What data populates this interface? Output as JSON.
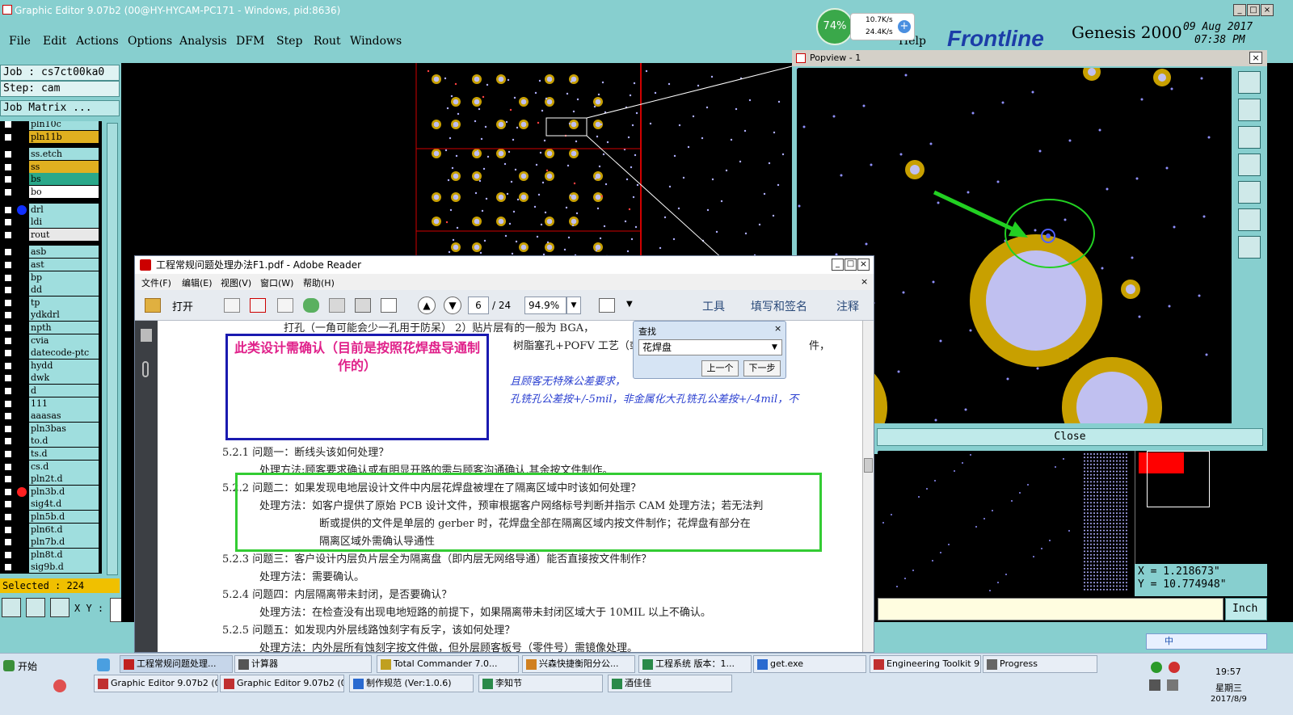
{
  "window": {
    "title": "Graphic Editor 9.07b2 (00@HY-HYCAM-PC171 - Windows, pid:8636)"
  },
  "menu": [
    "File",
    "Edit",
    "Actions",
    "Options",
    "Analysis",
    "DFM",
    "Step",
    "Rout",
    "Windows"
  ],
  "help_label": "Help",
  "brand": {
    "logo": "Frontline",
    "product": "Genesis 2000",
    "date": "09 Aug 2017",
    "time": "07:38 PM"
  },
  "net_widget": {
    "percent": "74%",
    "up": "10.7K/s",
    "down": "24.4K/s"
  },
  "job": {
    "job_label": "Job : cs7ct00ka0",
    "step_label": "Step: cam",
    "matrix_button": "Job Matrix ..."
  },
  "layers": [
    "pln10c",
    "pln11b",
    "ss.etch",
    "ss",
    "bs",
    "bo",
    "drl",
    "ldi",
    "rout",
    "asb",
    "ast",
    "bp",
    "dd",
    "tp",
    "ydkdrl",
    "npth",
    "cvia",
    "datecode-ptc",
    "hydd",
    "dwk",
    "d",
    "111",
    "aaasas",
    "pln3bas",
    "to.d",
    "ts.d",
    "cs.d",
    "pln2t.d",
    "pln3b.d",
    "sig4t.d",
    "pln5b.d",
    "pln6t.d",
    "pln7b.d",
    "pln8t.d",
    "sig9b.d"
  ],
  "selected": "Selected : 224",
  "xy_label": "X Y :",
  "popview": {
    "title": "Popview - 1",
    "close_label": "Close"
  },
  "coords": {
    "x": "X = 1.218673\"",
    "y": "Y = 10.774948\""
  },
  "units": "Inch",
  "pdf": {
    "title": "工程常规问题处理办法F1.pdf - Adobe Reader",
    "menu": [
      "文件(F)",
      "编辑(E)",
      "视图(V)",
      "窗口(W)",
      "帮助(H)"
    ],
    "open_label": "打开",
    "page": "6",
    "pages": "/ 24",
    "zoom": "94.9%",
    "tools": [
      "工具",
      "填写和签名",
      "注释"
    ],
    "find": {
      "title": "查找",
      "value": "花焊盘",
      "prev": "上一个",
      "next": "下一步"
    },
    "annotation": "此类设计需确认（目前是按照花焊盘导通制作的）",
    "lines": [
      "打孔（一角可能会少一孔用于防呆） 2）贴片层有的一般为 BGA，",
      "树脂塞孔+POFV 工艺（或激光",
      "且顾客无特殊公差要求，",
      "孔铣孔公差按+/-5mil，非金属化大孔铣孔公差按+/-4mil，不",
      "5.2.1  问题一：断线头该如何处理？",
      "处理方法:顾客要求确认或有明显开路的需与顾客沟通确认,其余按文件制作。",
      "5.2.2  问题二：如果发现电地层设计文件中内层花焊盘被埋在了隔离区域中时该如何处理？",
      "处理方法：如客户提供了原始 PCB 设计文件，预审根据客户网络标号判断并指示 CAM 处理方法；若无法判",
      "断或提供的文件是单层的 gerber 时，花焊盘全部在隔离区域内按文件制作；花焊盘有部分在",
      "隔离区域外需确认导通性",
      "5.2.3  问题三：客户设计内层负片层全为隔离盘（即内层无网络导通）能否直接按文件制作？",
      "处理方法：需要确认。",
      "5.2.4  问题四：内层隔离带未封闭，是否要确认？",
      "处理方法：在检查没有出现电地短路的前提下，如果隔离带未封闭区域大于 10MIL 以上不确认。",
      "5.2.5  问题五：如发现内外层线路蚀刻字有反字，该如何处理？",
      "处理方法：内外层所有蚀刻字按文件做，但外层顾客板号（零件号）需镜像处理。",
      "件，"
    ]
  },
  "taskbar": {
    "start": "开始",
    "row1": [
      "工程常规问题处理...",
      "计算器",
      "Total Commander 7.0...",
      "兴森快捷衡阳分公...",
      "工程系统  版本：1...",
      "get.exe",
      "Engineering Toolkit 9....",
      "Progress"
    ],
    "row2": [
      "Graphic Editor 9.07b2 (0...",
      "Graphic Editor 9.07b2 (0...",
      "制作规范 (Ver:1.0.6)",
      "李知节",
      "酒佳佳"
    ],
    "clock": "19:57",
    "weekday": "星期三",
    "date": "2017/8/9",
    "ime": "中"
  },
  "colors": {
    "panel": "#87cfcf",
    "pad": "#c8a000",
    "pad_fill": "#c0c0f0",
    "drill": "#b0b0ff"
  }
}
